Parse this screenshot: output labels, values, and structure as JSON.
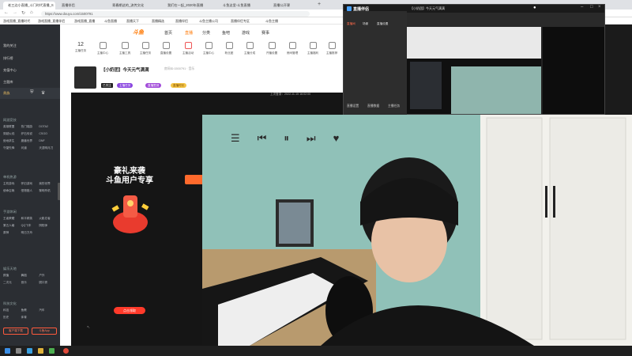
{
  "browser": {
    "tabs": [
      {
        "label": "老三边小直播_斗门时代直播_S",
        "active": true
      },
      {
        "label": "直播伴侣",
        "active": false
      },
      {
        "label": "青春期这的_流传文化",
        "active": false
      },
      {
        "label": "我们在一起_2020年直播",
        "active": false
      },
      {
        "label": "斗鱼这里-斗鱼直播",
        "active": false
      },
      {
        "label": "直播公开课",
        "active": false
      }
    ],
    "url": "https://www.douyu.com/1500791",
    "bookmarks": [
      "游戏直播_直播时代",
      "游戏直播_直播伴侣",
      "游戏直播_直播",
      "斗鱼直播",
      "直播天下",
      "直播精选",
      "直播伴侣",
      "斗鱼主播公司",
      "直播伴侣专区",
      "斗鱼主播"
    ]
  },
  "sidebar": {
    "items": [
      "我的关注",
      "排行榜",
      "充值中心",
      "主题库"
    ],
    "vip_label": "贵族",
    "sections": [
      {
        "title": "网游竞技",
        "tags": [
          "英雄联盟",
          "热门端游",
          "DOTA2",
          "穿越火线",
          "炉石传说",
          "CSGO",
          "绝地求生",
          "魔兽世界",
          "DNF",
          "守望先锋",
          "问道",
          "天涯明月刀"
        ]
      },
      {
        "title": "单机热游",
        "tags": [
          "主机游戏",
          "怀旧游戏",
          "我的世界",
          "使命召唤",
          "怪物猎人",
          "黎明杀机"
        ]
      },
      {
        "title": "手游休闲",
        "tags": [
          "王者荣耀",
          "和平精英",
          "火影忍者",
          "第五人格",
          "QQ飞车",
          "阴阳师",
          "原神",
          "明日方舟"
        ]
      },
      {
        "title": "娱乐天地",
        "tags": [
          "颜值",
          "舞蹈",
          "户外",
          "二次元",
          "音乐",
          "脱口秀"
        ]
      },
      {
        "title": "科技文化",
        "tags": [
          "科技",
          "鱼教",
          "汽车",
          "历史",
          "体育"
        ]
      }
    ],
    "footer_buttons": [
      "客户端下载",
      "斗鱼App"
    ]
  },
  "main": {
    "nav": {
      "logo": "斗鱼",
      "links": [
        "首页",
        "直播",
        "分类",
        "鱼吧",
        "游戏",
        "赛事"
      ]
    },
    "level": "12",
    "icon_labels": [
      "主播任务",
      "主播中心",
      "主播工具",
      "主播任务",
      "直播设置",
      "主播活动",
      "主播中心",
      "粉丝团",
      "主播分成",
      "开播设置",
      "房间管理",
      "主播福利",
      "主播推荐"
    ],
    "room": {
      "title": "【小奶团】今天元气满满",
      "meta": "房间ID:1500791 · 音乐",
      "badges": [
        "已关注",
        "主播任务",
        "直播签到",
        "直播时长"
      ]
    },
    "promo": {
      "line1": "豪礼来袭",
      "line2": "斗鱼用户专享",
      "button": "点击领取"
    },
    "player_time": "上次登录：2022-11-15 16:02:00"
  },
  "studio": {
    "brand": "直播伴侣",
    "tabs": [
      "直播间",
      "场景",
      "直播设置"
    ],
    "window_title": "【小奶团】今天元气满满",
    "bottom_buttons": [
      "直播设置",
      "直播数据",
      "主播任务"
    ]
  },
  "music_controls": [
    "prev",
    "pause",
    "next",
    "heart"
  ],
  "colors": {
    "brand_orange": "#ff7700",
    "sidebar_bg": "#2b2e33",
    "wall_teal": "#8fc0b8",
    "badge_purple": "#8a46e0"
  }
}
